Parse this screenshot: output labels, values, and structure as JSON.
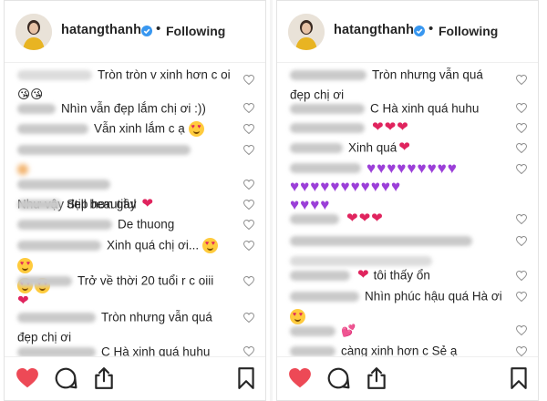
{
  "panels": [
    {
      "id": "left",
      "header": {
        "username": "hatangthanh",
        "dot": "•",
        "status": "Following"
      },
      "comments": [
        {
          "text": "Tròn tròn v xinh hơn c oi"
        },
        {
          "text": "Nhìn vẫn đẹp lắm chị ơi :))"
        },
        {
          "text": "Vẫn xinh lắm c ạ"
        },
        {
          "text": "Như vậy đẹp hơn gầy"
        },
        {
          "text": "Still beautiful"
        },
        {
          "text": "De thuong"
        },
        {
          "text": "Xinh quá chị ơi..."
        },
        {
          "text": "Trở về thời 20 tuổi r c oiii"
        },
        {
          "text": "Tròn nhưng vẫn quá đẹp chị ơi"
        },
        {
          "text": "C Hà xinh quá huhu"
        }
      ]
    },
    {
      "id": "right",
      "header": {
        "username": "hatangthanh",
        "dot": "•",
        "status": "Following"
      },
      "comments": [
        {
          "text": "Tròn nhưng vẫn quá đẹp chị ơi"
        },
        {
          "text": "C Hà xinh quá huhu"
        },
        {
          "text": "Xinh quá"
        },
        {
          "text": "tôi thấy ổn"
        },
        {
          "text": "Nhìn phúc hậu quá Hà ơi"
        },
        {
          "text": "càng xinh hơn c Sẻ ạ"
        }
      ]
    }
  ],
  "icons": {
    "verified": "verified-badge-icon",
    "comment_like": "heart-outline-icon",
    "like": "heart-filled-icon",
    "comment": "comment-bubble-icon",
    "share": "share-icon",
    "save": "bookmark-icon"
  },
  "colors": {
    "like_red": "#ed4956",
    "verified_blue": "#3897f0",
    "heart_purple": "#9b3fd8",
    "text": "#262626"
  }
}
